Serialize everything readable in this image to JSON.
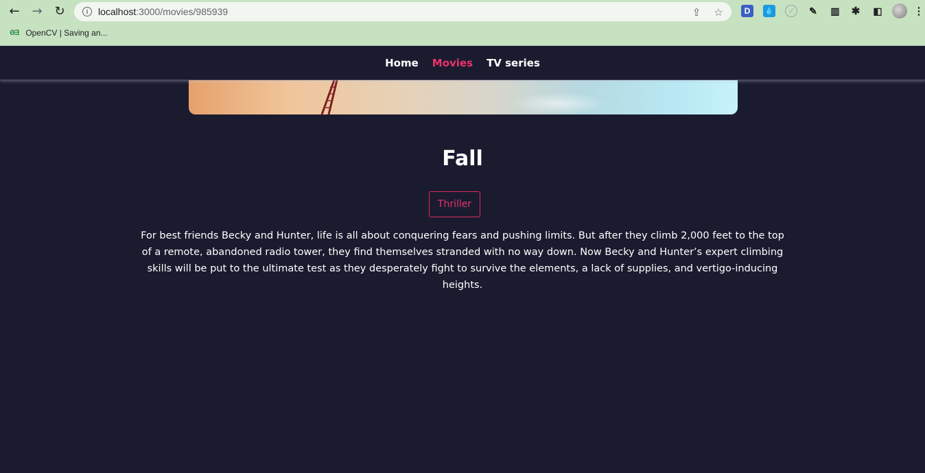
{
  "browser": {
    "url_host": "localhost",
    "url_path": ":3000/movies/985939",
    "bookmark_label": "OpenCV | Saving an...",
    "bookmark_icon": "gfg-icon"
  },
  "nav": {
    "items": [
      {
        "label": "Home",
        "active": false
      },
      {
        "label": "Movies",
        "active": true
      },
      {
        "label": "TV series",
        "active": false
      }
    ]
  },
  "movie": {
    "title": "Fall",
    "genre": "Thriller",
    "overview": "For best friends Becky and Hunter, life is all about conquering fears and pushing limits. But after they climb 2,000 feet to the top of a remote, abandoned radio tower, they find themselves stranded with no way down. Now Becky and Hunter’s expert climbing skills will be put to the ultimate test as they desperately fight to survive the elements, a lack of supplies, and vertigo-inducing heights."
  },
  "colors": {
    "background": "#1b1b2f",
    "accent": "#e8336b",
    "chrome": "#c7e2c1"
  }
}
